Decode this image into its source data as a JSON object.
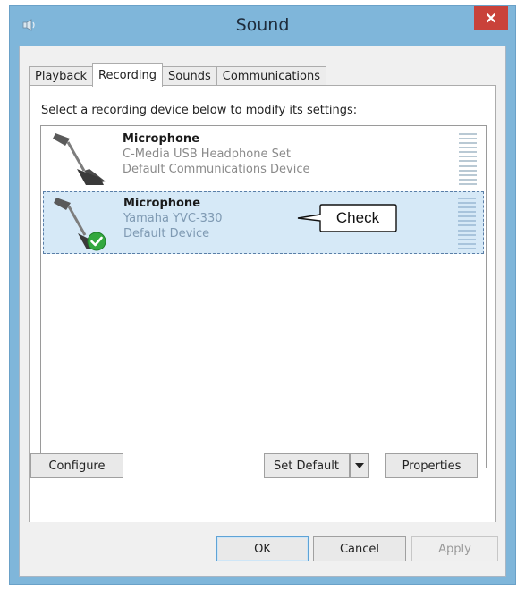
{
  "window": {
    "title": "Sound",
    "close_glyph": "✕"
  },
  "tabs": [
    {
      "label": "Playback",
      "active": false
    },
    {
      "label": "Recording",
      "active": true
    },
    {
      "label": "Sounds",
      "active": false
    },
    {
      "label": "Communications",
      "active": false
    }
  ],
  "panel": {
    "instruction": "Select a recording device below to modify its settings:",
    "devices": [
      {
        "name": "Microphone",
        "detail": "C-Media USB Headphone Set",
        "status": "Default Communications Device",
        "icon": "microphone-icon",
        "selected": false
      },
      {
        "name": "Microphone",
        "detail": "Yamaha YVC-330",
        "status": "Default Device",
        "icon": "microphone-icon",
        "badge_icon": "green-check-icon",
        "selected": true
      }
    ],
    "callout": "Check",
    "buttons": {
      "configure": "Configure",
      "set_default": "Set Default",
      "properties": "Properties"
    }
  },
  "footer": {
    "ok": "OK",
    "cancel": "Cancel",
    "apply": "Apply"
  },
  "colors": {
    "frame": "#7fb6da",
    "close": "#c9423a",
    "selected_row": "#d6e9f7"
  }
}
